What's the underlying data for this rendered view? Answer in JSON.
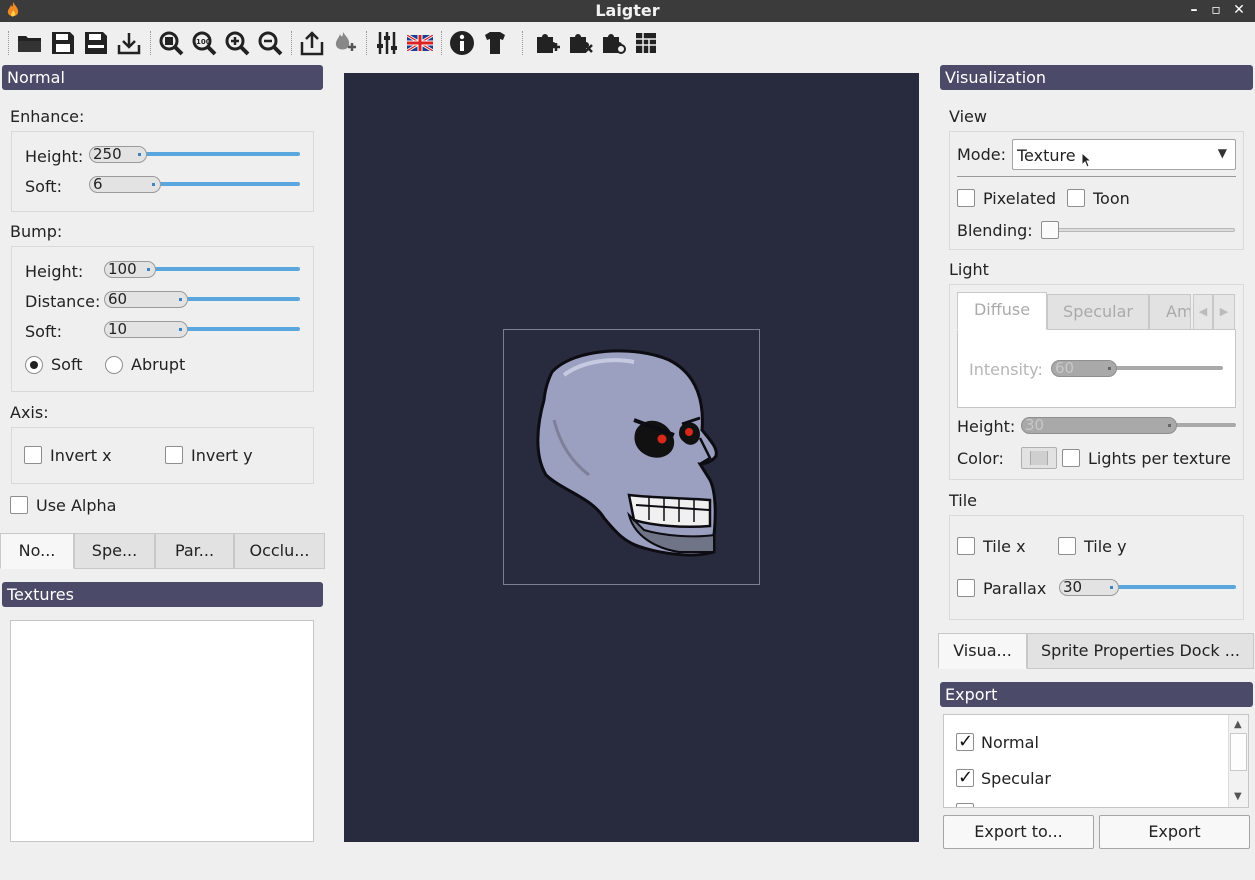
{
  "window": {
    "title": "Laigter"
  },
  "toolbar": {
    "icons": [
      "open-folder-icon",
      "save-icon",
      "save-as-icon",
      "import-icon",
      "zoom-fit-icon",
      "zoom-100-icon",
      "zoom-in-icon",
      "zoom-out-icon",
      "export-share-icon",
      "add-light-icon",
      "settings-sliders-icon",
      "language-flag-icon",
      "info-icon",
      "theme-shirt-icon",
      "plugin-add-icon",
      "plugin-remove-icon",
      "plugin-settings-icon",
      "presets-icon"
    ]
  },
  "normal_dock": {
    "title": "Normal",
    "enhance": {
      "label": "Enhance:",
      "height_label": "Height:",
      "height_value": "250",
      "soft_label": "Soft:",
      "soft_value": "6"
    },
    "bump": {
      "label": "Bump:",
      "height_label": "Height:",
      "height_value": "100",
      "distance_label": "Distance:",
      "distance_value": "60",
      "soft_label": "Soft:",
      "soft_value": "10",
      "radio_soft": "Soft",
      "radio_abrupt": "Abrupt",
      "mode_selected": "Soft"
    },
    "axis": {
      "label": "Axis:",
      "invert_x": "Invert x",
      "invert_y": "Invert y"
    },
    "use_alpha": "Use Alpha",
    "tabs": [
      "No...",
      "Spe...",
      "Par...",
      "Occlu..."
    ]
  },
  "textures_dock": {
    "title": "Textures"
  },
  "visualization_dock": {
    "title": "Visualization",
    "view": {
      "label": "View",
      "mode_label": "Mode:",
      "mode_value": "Texture",
      "pixelated": "Pixelated",
      "toon": "Toon",
      "blending_label": "Blending:"
    },
    "light": {
      "label": "Light",
      "tabs": [
        "Diffuse",
        "Specular",
        "Am"
      ],
      "intensity_label": "Intensity:",
      "intensity_value": "60",
      "height_label": "Height:",
      "height_value": "30",
      "color_label": "Color:",
      "lights_per_texture": "Lights per texture"
    },
    "tile": {
      "label": "Tile",
      "tile_x": "Tile x",
      "tile_y": "Tile y",
      "parallax": "Parallax",
      "parallax_value": "30"
    },
    "tabs": [
      "Visua...",
      "Sprite Properties Dock ..."
    ]
  },
  "export_dock": {
    "title": "Export",
    "items": [
      {
        "label": "Normal",
        "checked": true
      },
      {
        "label": "Specular",
        "checked": true
      }
    ],
    "export_to": "Export to...",
    "export": "Export"
  },
  "colors": {
    "dock_header": "#4b4a68",
    "canvas": "#282a3d",
    "accent": "#5aa6de"
  }
}
